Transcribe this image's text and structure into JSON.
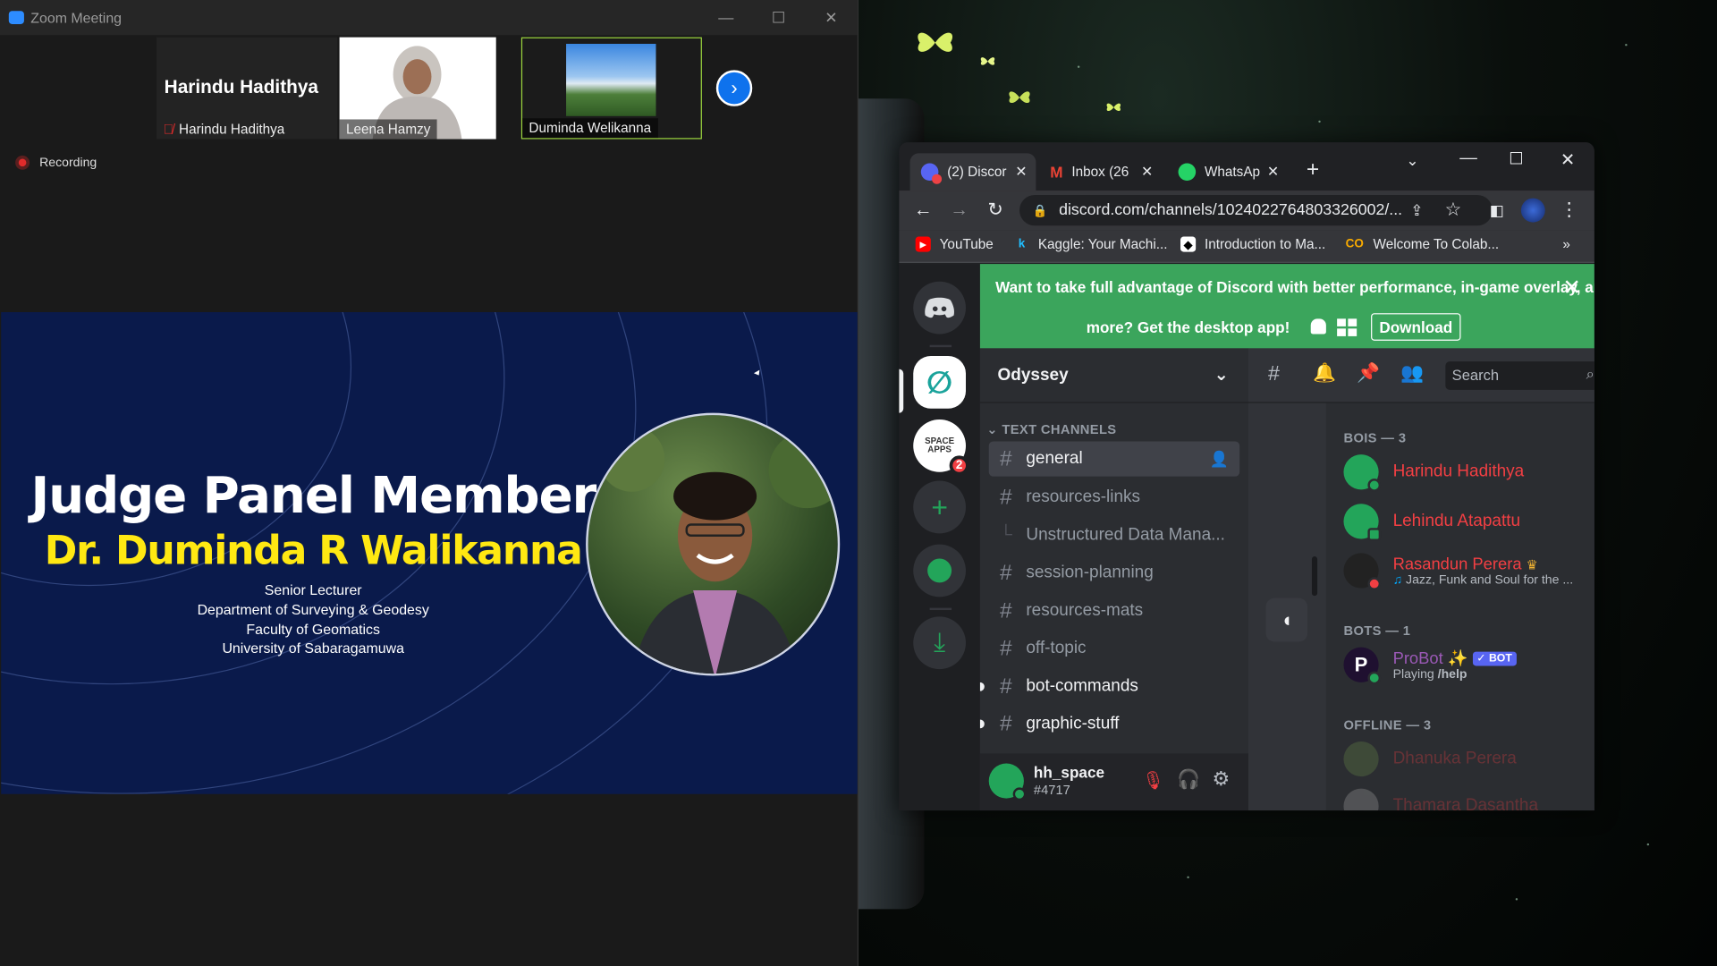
{
  "zoom": {
    "window_title": "Zoom Meeting",
    "participants": [
      {
        "display": "Harindu Hadithya",
        "name": "Harindu Hadithya",
        "muted": true
      },
      {
        "name": "Leena Hamzy"
      },
      {
        "name": "Duminda Welikanna",
        "active": true
      }
    ],
    "recording_label": "Recording",
    "slide": {
      "title": "Judge Panel Member",
      "name": "Dr. Duminda R Walikanna",
      "lines": [
        "Senior Lecturer",
        "Department of Surveying & Geodesy",
        "Faculty of Geomatics",
        "University of Sabaragamuwa"
      ]
    }
  },
  "browser": {
    "tabs": [
      {
        "label": "(2) Discor",
        "icon": "discord-icon"
      },
      {
        "label": "Inbox (26",
        "icon": "gmail-icon"
      },
      {
        "label": "WhatsAp",
        "icon": "whatsapp-icon"
      }
    ],
    "url": "discord.com/channels/1024022764803326002/...",
    "bookmarks": [
      {
        "label": "YouTube",
        "icon": "youtube-icon"
      },
      {
        "label": "Kaggle: Your Machi...",
        "icon": "kaggle-icon"
      },
      {
        "label": "Introduction to Ma...",
        "icon": "notion-icon"
      },
      {
        "label": "Welcome To Colab...",
        "icon": "colab-icon"
      }
    ],
    "more_bookmarks": "»"
  },
  "discord": {
    "banner_line1": "Want to take full advantage of Discord with better performance, in-game overlay, and",
    "banner_line2": "more? Get the desktop app!",
    "download_label": "Download",
    "server_badge": "2",
    "server_name": "Odyssey",
    "category": "TEXT CHANNELS",
    "channels": [
      {
        "name": "general",
        "selected": true
      },
      {
        "name": "resources-links"
      },
      {
        "name": "Unstructured Data Mana...",
        "thread": true
      },
      {
        "name": "session-planning"
      },
      {
        "name": "resources-mats"
      },
      {
        "name": "off-topic"
      },
      {
        "name": "bot-commands",
        "unread": true
      },
      {
        "name": "graphic-stuff",
        "unread": true
      }
    ],
    "user": {
      "name": "hh_space",
      "tag": "#4717"
    },
    "search_placeholder": "Search",
    "groups": {
      "bois": "BOIS — 3",
      "bots": "BOTS — 1",
      "offline": "OFFLINE — 3"
    },
    "members": {
      "m1": {
        "name": "Harindu Hadithya",
        "color": "#f23f43"
      },
      "m2": {
        "name": "Lehindu Atapattu",
        "color": "#f23f43"
      },
      "m3": {
        "name": "Rasandun Perera",
        "status": "Jazz, Funk and Soul for the ...",
        "color": "#f23f43"
      },
      "bot": {
        "name": "ProBot",
        "badge": "✓ BOT",
        "status_prefix": "Playing",
        "status": "/help",
        "color": "#9b59b6"
      },
      "off1": {
        "name": "Dhanuka Perera",
        "color": "#f23f43"
      },
      "off2": {
        "name": "Thamara Dasantha",
        "color": "#f23f43"
      }
    }
  }
}
